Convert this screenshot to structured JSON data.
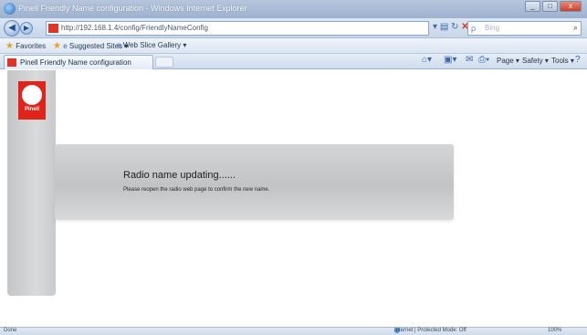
{
  "window": {
    "title": "Pinell Friendly Name configuration - Windows Internet Explorer",
    "controls": [
      "_",
      "□",
      "x"
    ]
  },
  "address_bar": {
    "url": "http://192.168.1.4/config/FriendlyNameConfig",
    "search_placeholder": "Bing"
  },
  "favorites_bar": {
    "favorites_label": "Favorites",
    "suggested_sites_label": "Suggested Sites ▾",
    "web_slice_gallery_label": "Web Slice Gallery ▾"
  },
  "tab": {
    "label": "Pinell Friendly Name configuration"
  },
  "command_bar": {
    "page_label": "Page ▾",
    "safety_label": "Safety ▾",
    "tools_label": "Tools ▾"
  },
  "page": {
    "logo_text": "Pinell",
    "heading": "Radio name updating......",
    "message": "Please reopen the radio web page to confirm the new name."
  },
  "status_bar": {
    "left": "Done",
    "zone": "Internet | Protected Mode: Off",
    "zoom": "100%"
  },
  "colors": {
    "brand_red": "#e2231a",
    "panel_gray": "#c8c9cb"
  }
}
